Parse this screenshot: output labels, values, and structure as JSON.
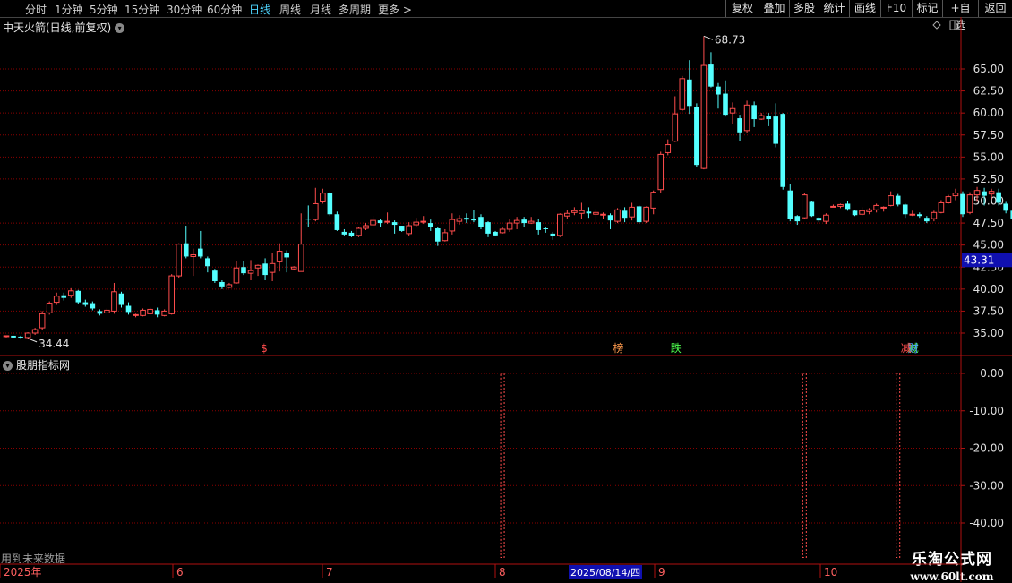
{
  "toolbar": {
    "periods": [
      {
        "label": "分时",
        "active": false
      },
      {
        "label": "1分钟",
        "active": false
      },
      {
        "label": "5分钟",
        "active": false
      },
      {
        "label": "15分钟",
        "active": false
      },
      {
        "label": "30分钟",
        "active": false
      },
      {
        "label": "60分钟",
        "active": false
      },
      {
        "label": "日线",
        "active": true
      },
      {
        "label": "周线",
        "active": false
      },
      {
        "label": "月线",
        "active": false
      },
      {
        "label": "多周期",
        "active": false
      },
      {
        "label": "更多",
        "active": false
      }
    ],
    "right_buttons": [
      "复权",
      "叠加",
      "多股",
      "统计",
      "画线",
      "F10",
      "标记",
      "+自选",
      "返回"
    ]
  },
  "chart_title": "中天火箭(日线,前复权)",
  "indicator_title": "股朋指标网",
  "future_data_note": "用到未来数据",
  "watermark": {
    "line1": "乐淘公式网",
    "line2": "www.60lt.com"
  },
  "colors": {
    "up": "#ff4d4d",
    "down": "#54ffff",
    "grid": "#8b0000",
    "axis": "#b01010",
    "label_bg": "#1010b0"
  },
  "chart_data": [
    {
      "type": "candlestick",
      "title": "中天火箭(日线,前复权)",
      "y_ticks": [
        35.0,
        37.5,
        40.0,
        42.5,
        45.0,
        47.5,
        50.0,
        52.5,
        55.0,
        57.5,
        60.0,
        62.5,
        65.0
      ],
      "ylim": [
        33.5,
        68.9
      ],
      "high_label": "68.73",
      "low_label": "34.44",
      "current_price_label": "43.31",
      "candles": [
        [
          34.6,
          34.7,
          34.5,
          34.6
        ],
        [
          34.7,
          34.5,
          34.5,
          34.7
        ],
        [
          34.6,
          34.5,
          34.44,
          34.7
        ],
        [
          34.5,
          35.0,
          34.4,
          35.1
        ],
        [
          35.0,
          35.4,
          34.8,
          35.6
        ],
        [
          35.6,
          37.2,
          35.4,
          37.5
        ],
        [
          37.3,
          38.4,
          37.1,
          38.6
        ],
        [
          38.5,
          39.2,
          38.2,
          39.6
        ],
        [
          39.3,
          39.0,
          38.7,
          39.6
        ],
        [
          39.3,
          39.8,
          39.0,
          40.1
        ],
        [
          39.8,
          38.5,
          38.3,
          39.9
        ],
        [
          38.5,
          38.2,
          38.0,
          38.8
        ],
        [
          38.4,
          37.8,
          37.6,
          38.6
        ],
        [
          37.5,
          37.2,
          37.0,
          37.7
        ],
        [
          37.3,
          37.6,
          37.2,
          37.8
        ],
        [
          37.5,
          39.7,
          37.2,
          40.7
        ],
        [
          39.5,
          38.2,
          37.9,
          39.7
        ],
        [
          38.1,
          37.4,
          37.1,
          38.5
        ],
        [
          37.1,
          37.1,
          36.8,
          37.2
        ],
        [
          37.0,
          37.6,
          36.9,
          37.8
        ],
        [
          37.2,
          37.7,
          37.1,
          37.9
        ],
        [
          37.6,
          37.1,
          36.8,
          37.9
        ],
        [
          37.0,
          37.5,
          36.9,
          37.7
        ],
        [
          37.2,
          41.5,
          37.1,
          41.7
        ],
        [
          41.5,
          45.1,
          41.3,
          45.2
        ],
        [
          45.2,
          43.7,
          43.5,
          47.2
        ],
        [
          43.7,
          43.9,
          41.5,
          44.6
        ],
        [
          44.6,
          43.7,
          43.5,
          46.6
        ],
        [
          43.5,
          42.6,
          41.9,
          43.7
        ],
        [
          42.1,
          40.9,
          40.7,
          42.3
        ],
        [
          40.8,
          40.3,
          40.0,
          41.0
        ],
        [
          40.2,
          40.5,
          40.1,
          40.7
        ],
        [
          40.7,
          42.4,
          40.6,
          43.2
        ],
        [
          42.5,
          41.8,
          41.6,
          43.2
        ],
        [
          41.8,
          42.1,
          41.0,
          43.3
        ],
        [
          42.4,
          42.7,
          41.5,
          42.8
        ],
        [
          42.9,
          41.6,
          41.0,
          43.5
        ],
        [
          41.9,
          42.9,
          40.9,
          44.1
        ],
        [
          43.1,
          44.3,
          42.0,
          45.2
        ],
        [
          44.1,
          43.6,
          41.9,
          44.4
        ],
        [
          42.3,
          42.5,
          42.2,
          42.6
        ],
        [
          42.0,
          45.1,
          42.0,
          48.6
        ],
        [
          48.0,
          47.9,
          47.0,
          49.5
        ],
        [
          47.9,
          49.7,
          47.7,
          51.5
        ],
        [
          49.9,
          50.9,
          49.7,
          51.4
        ],
        [
          50.9,
          48.5,
          48.3,
          51.0
        ],
        [
          48.5,
          46.7,
          46.6,
          48.8
        ],
        [
          46.5,
          46.2,
          46.1,
          46.8
        ],
        [
          46.4,
          46.0,
          45.9,
          46.6
        ],
        [
          46.1,
          46.9,
          45.9,
          47.1
        ],
        [
          46.9,
          47.2,
          46.7,
          47.5
        ],
        [
          47.3,
          47.8,
          47.2,
          48.3
        ],
        [
          47.8,
          47.5,
          47.0,
          48.0
        ],
        [
          47.6,
          47.7,
          47.4,
          48.7
        ],
        [
          47.6,
          47.3,
          46.3,
          47.8
        ],
        [
          47.2,
          46.6,
          46.5,
          47.2
        ],
        [
          46.3,
          47.2,
          46.0,
          47.6
        ],
        [
          47.3,
          47.6,
          47.1,
          48.1
        ],
        [
          47.6,
          47.7,
          47.4,
          48.3
        ],
        [
          47.5,
          47.0,
          46.6,
          47.9
        ],
        [
          46.9,
          45.4,
          44.9,
          47.1
        ],
        [
          45.5,
          46.4,
          45.4,
          46.8
        ],
        [
          46.6,
          47.9,
          46.2,
          48.6
        ],
        [
          47.7,
          48.0,
          47.3,
          48.4
        ],
        [
          48.1,
          47.9,
          47.5,
          48.6
        ],
        [
          48.0,
          47.8,
          47.6,
          49.0
        ],
        [
          48.2,
          47.1,
          46.8,
          48.5
        ],
        [
          47.6,
          46.3,
          45.9,
          47.7
        ],
        [
          46.5,
          46.1,
          46.0,
          46.6
        ],
        [
          46.4,
          46.8,
          46.3,
          47.0
        ],
        [
          46.8,
          47.5,
          46.5,
          48.0
        ],
        [
          47.5,
          47.8,
          46.8,
          48.2
        ],
        [
          47.9,
          47.5,
          47.1,
          48.2
        ],
        [
          47.5,
          47.7,
          47.4,
          48.2
        ],
        [
          47.6,
          46.7,
          46.2,
          48.0
        ],
        [
          46.9,
          46.8,
          46.4,
          47.0
        ],
        [
          46.3,
          46.0,
          45.6,
          46.5
        ],
        [
          46.1,
          48.5,
          45.9,
          48.6
        ],
        [
          48.3,
          48.6,
          48.0,
          49.0
        ],
        [
          48.7,
          48.9,
          48.4,
          49.3
        ],
        [
          48.6,
          48.9,
          48.0,
          49.8
        ],
        [
          48.8,
          48.6,
          48.1,
          49.3
        ],
        [
          48.5,
          48.7,
          47.5,
          49.1
        ],
        [
          48.5,
          48.5,
          48.0,
          48.7
        ],
        [
          48.4,
          47.8,
          46.8,
          48.6
        ],
        [
          47.7,
          49.0,
          47.5,
          49.2
        ],
        [
          48.9,
          48.1,
          47.6,
          49.3
        ],
        [
          48.2,
          49.3,
          47.8,
          49.8
        ],
        [
          49.4,
          47.6,
          47.4,
          49.5
        ],
        [
          47.7,
          49.3,
          47.5,
          49.4
        ],
        [
          49.2,
          51.0,
          48.5,
          51.2
        ],
        [
          51.3,
          55.3,
          50.9,
          55.6
        ],
        [
          55.5,
          56.4,
          55.2,
          57.0
        ],
        [
          56.8,
          59.9,
          56.7,
          61.9
        ],
        [
          60.4,
          63.9,
          60.2,
          64.2
        ],
        [
          63.8,
          60.8,
          59.9,
          66.0
        ],
        [
          60.7,
          54.1,
          53.9,
          61.1
        ],
        [
          53.7,
          65.4,
          53.6,
          68.73
        ],
        [
          65.5,
          63.0,
          62.9,
          66.9
        ],
        [
          63.0,
          62.1,
          60.5,
          63.4
        ],
        [
          62.2,
          59.8,
          59.6,
          63.7
        ],
        [
          60.0,
          60.5,
          58.7,
          61.2
        ],
        [
          59.4,
          57.8,
          56.8,
          59.8
        ],
        [
          58.0,
          60.9,
          57.7,
          61.4
        ],
        [
          60.9,
          59.3,
          58.4,
          61.3
        ],
        [
          59.3,
          59.7,
          59.2,
          60.0
        ],
        [
          59.7,
          59.3,
          58.5,
          60.0
        ],
        [
          59.6,
          56.5,
          56.1,
          61.1
        ],
        [
          59.9,
          51.6,
          51.3,
          60.0
        ],
        [
          51.2,
          48.0,
          47.7,
          51.9
        ],
        [
          48.3,
          47.7,
          47.3,
          48.4
        ],
        [
          48.1,
          50.7,
          48.0,
          50.9
        ],
        [
          49.9,
          48.3,
          48.2,
          50.0
        ],
        [
          48.1,
          47.8,
          47.6,
          48.2
        ],
        [
          47.7,
          48.4,
          47.4,
          48.6
        ],
        [
          49.4,
          49.4,
          49.3,
          49.6
        ],
        [
          49.4,
          49.6,
          49.2,
          49.7
        ],
        [
          49.7,
          49.1,
          48.9,
          50.0
        ],
        [
          48.9,
          48.4,
          48.3,
          49.0
        ],
        [
          48.5,
          48.9,
          48.3,
          49.3
        ],
        [
          48.8,
          49.0,
          48.5,
          49.2
        ],
        [
          49.0,
          49.5,
          48.7,
          49.7
        ],
        [
          49.2,
          49.3,
          48.8,
          49.4
        ],
        [
          49.5,
          50.6,
          49.4,
          51.1
        ],
        [
          50.6,
          49.6,
          49.4,
          50.8
        ],
        [
          49.6,
          48.5,
          48.1,
          49.7
        ],
        [
          48.4,
          48.5,
          48.3,
          48.9
        ],
        [
          48.5,
          48.3,
          48.1,
          48.7
        ],
        [
          48.1,
          47.7,
          47.5,
          48.3
        ],
        [
          48.0,
          48.7,
          47.7,
          48.9
        ],
        [
          48.7,
          49.8,
          48.6,
          50.1
        ],
        [
          49.8,
          50.5,
          49.7,
          50.7
        ],
        [
          50.6,
          50.9,
          50.1,
          51.4
        ],
        [
          50.8,
          48.5,
          48.2,
          51.1
        ],
        [
          48.7,
          50.7,
          48.5,
          51.0
        ],
        [
          50.7,
          51.2,
          49.9,
          51.6
        ],
        [
          51.1,
          50.6,
          49.5,
          51.5
        ],
        [
          50.8,
          51.1,
          50.2,
          51.4
        ],
        [
          51.0,
          49.8,
          49.5,
          51.4
        ],
        [
          49.7,
          48.9,
          48.6,
          49.9
        ],
        [
          48.9,
          48.0,
          47.6,
          49.0
        ],
        [
          48.5,
          49.4,
          48.2,
          49.6
        ],
        [
          49.1,
          48.4,
          48.0,
          49.3
        ],
        [
          48.7,
          48.9,
          48.3,
          49.0
        ],
        [
          48.8,
          48.7,
          48.4,
          49.1
        ],
        [
          48.8,
          48.1,
          47.4,
          48.9
        ],
        [
          48.7,
          52.7,
          48.6,
          53.2
        ],
        [
          52.6,
          55.2,
          52.4,
          55.7
        ],
        [
          54.2,
          52.9,
          52.7,
          55.0
        ],
        [
          53.1,
          54.4,
          52.5,
          55.0
        ],
        [
          54.2,
          56.8,
          54.0,
          59.0
        ],
        [
          55.9,
          54.8,
          54.6,
          56.5
        ]
      ]
    },
    {
      "type": "bar",
      "title": "股朋指标网",
      "y_ticks": [
        0.0,
        -10.0,
        -20.0,
        -30.0,
        -40.0
      ],
      "ylim": [
        -42.5,
        0.5
      ],
      "x_dates": [
        "2025年",
        "6",
        "7",
        "8",
        "2025/08/14/四",
        "9",
        "10"
      ],
      "bars": [
        {
          "index": 69,
          "value": -42.5
        },
        {
          "index": 111,
          "value": -42.5
        },
        {
          "index": 124,
          "value": -42.5
        }
      ]
    }
  ],
  "markers": [
    {
      "index": 36,
      "text": "$",
      "color": "#ff4d4d"
    },
    {
      "index": 85,
      "text": "榜",
      "color": "#ff9a4d"
    },
    {
      "index": 93,
      "text": "跌",
      "color": "#4dff4d"
    },
    {
      "index": 126,
      "text": "减",
      "color": "#4dff4d"
    },
    {
      "index": 126,
      "text": "财",
      "color": "#4d9aff"
    },
    {
      "index": 125,
      "text": "减",
      "color": "#ff4d4d"
    }
  ]
}
